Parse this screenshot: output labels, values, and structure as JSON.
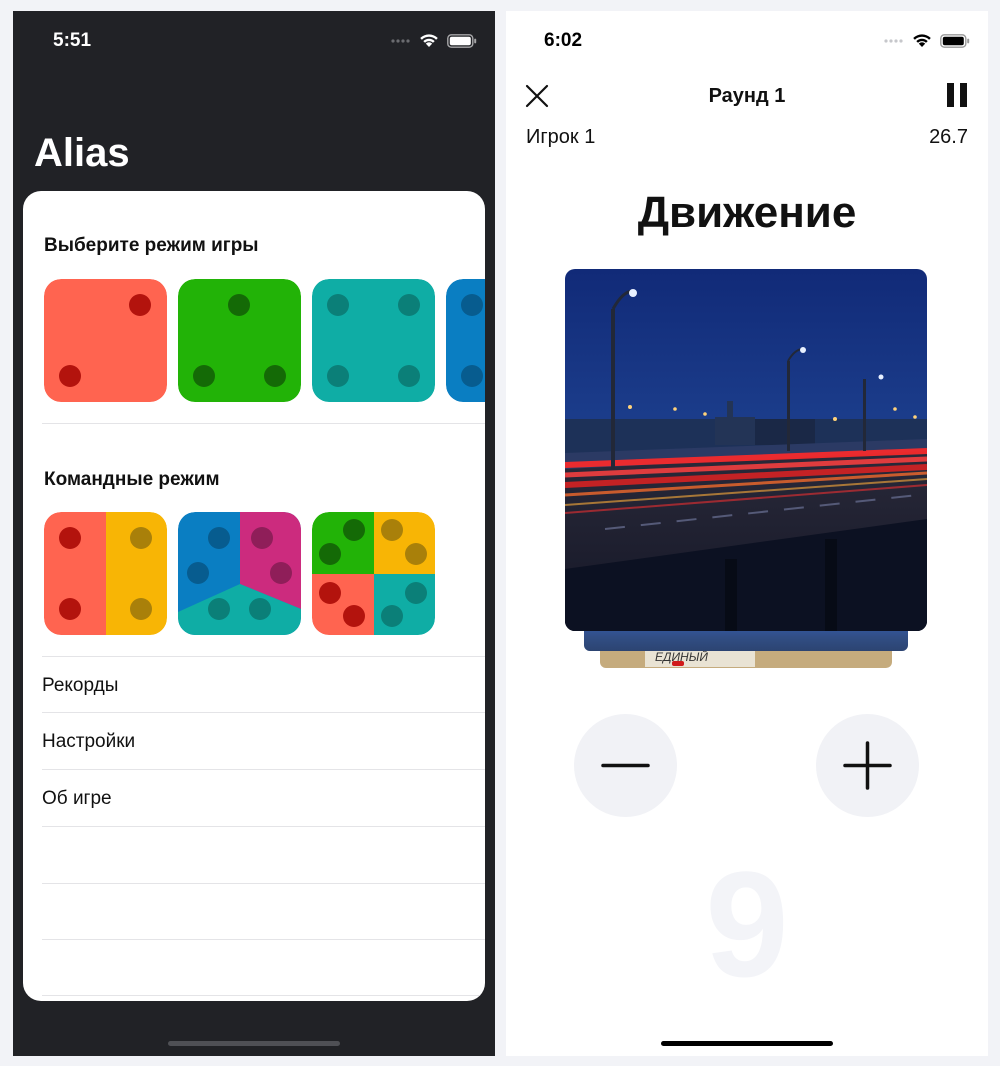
{
  "left_screen": {
    "status_time": "5:51",
    "app_title": "Alias",
    "game_modes_heading": "Выберите режим игры",
    "team_modes_heading": "Командные режим",
    "menu": [
      {
        "label": "Рекорды"
      },
      {
        "label": "Настройки"
      },
      {
        "label": "Об игре"
      }
    ],
    "dice_colors": {
      "coral": "#ff6450",
      "green": "#22b307",
      "teal": "#0fada5",
      "blue": "#0a7ec2",
      "yellow": "#f8b505",
      "magenta": "#cc2b7e"
    }
  },
  "right_screen": {
    "status_time": "6:02",
    "round_title": "Раунд 1",
    "player": "Игрок 1",
    "timer": "26.7",
    "word": "Движение",
    "photo_stamp_text": "ЕДИНЫЙ",
    "score": "9",
    "minus_icon": "minus-icon",
    "plus_icon": "plus-icon"
  }
}
